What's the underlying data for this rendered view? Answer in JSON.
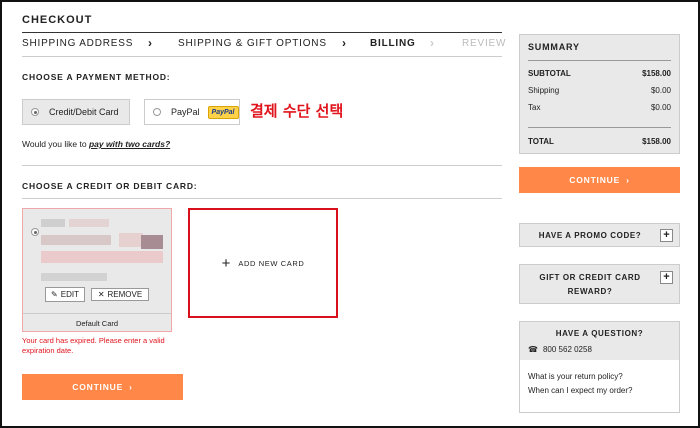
{
  "header": {
    "title": "CHECKOUT"
  },
  "steps": [
    {
      "label": "SHIPPING ADDRESS"
    },
    {
      "label": "SHIPPING & GIFT OPTIONS"
    },
    {
      "label": "BILLING"
    },
    {
      "label": "REVIEW"
    }
  ],
  "payment": {
    "section_label": "CHOOSE A PAYMENT METHOD:",
    "option_card": "Credit/Debit Card",
    "option_paypal": "PayPal",
    "paypal_badge": "PayPal",
    "annotation": "결제 수단 선택",
    "two_cards_prefix": "Would you like to ",
    "two_cards_link": "pay with two cards?"
  },
  "cards": {
    "section_label": "CHOOSE A CREDIT OR DEBIT CARD:",
    "edit_label": "EDIT",
    "remove_label": "REMOVE",
    "default_label": "Default Card",
    "error_text": "Your card has expired. Please enter a valid expiration date.",
    "add_new_label": "ADD NEW CARD"
  },
  "continue_label": "CONTINUE",
  "summary": {
    "title": "SUMMARY",
    "subtotal_label": "SUBTOTAL",
    "subtotal_value": "$158.00",
    "shipping_label": "Shipping",
    "shipping_value": "$0.00",
    "tax_label": "Tax",
    "tax_value": "$0.00",
    "total_label": "TOTAL",
    "total_value": "$158.00"
  },
  "promo": {
    "label": "HAVE A PROMO CODE?"
  },
  "gift": {
    "label_line1": "GIFT OR CREDIT CARD",
    "label_line2": "REWARD?"
  },
  "help": {
    "title": "HAVE A QUESTION?",
    "phone": "800 562 0258",
    "link1": "What is your return policy?",
    "link2": "When can I expect my order?"
  },
  "colors": {
    "accent": "#ff8747",
    "error": "#e0141d",
    "panel": "#e9e9e9"
  }
}
